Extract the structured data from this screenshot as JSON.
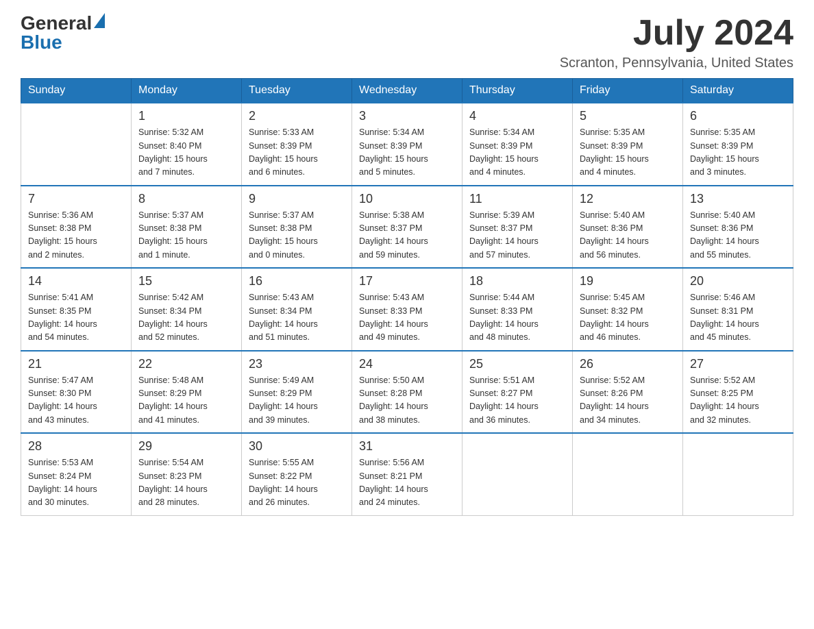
{
  "header": {
    "logo_general": "General",
    "logo_blue": "Blue",
    "month_year": "July 2024",
    "location": "Scranton, Pennsylvania, United States"
  },
  "days_of_week": [
    "Sunday",
    "Monday",
    "Tuesday",
    "Wednesday",
    "Thursday",
    "Friday",
    "Saturday"
  ],
  "weeks": [
    [
      {
        "day": "",
        "info": ""
      },
      {
        "day": "1",
        "info": "Sunrise: 5:32 AM\nSunset: 8:40 PM\nDaylight: 15 hours\nand 7 minutes."
      },
      {
        "day": "2",
        "info": "Sunrise: 5:33 AM\nSunset: 8:39 PM\nDaylight: 15 hours\nand 6 minutes."
      },
      {
        "day": "3",
        "info": "Sunrise: 5:34 AM\nSunset: 8:39 PM\nDaylight: 15 hours\nand 5 minutes."
      },
      {
        "day": "4",
        "info": "Sunrise: 5:34 AM\nSunset: 8:39 PM\nDaylight: 15 hours\nand 4 minutes."
      },
      {
        "day": "5",
        "info": "Sunrise: 5:35 AM\nSunset: 8:39 PM\nDaylight: 15 hours\nand 4 minutes."
      },
      {
        "day": "6",
        "info": "Sunrise: 5:35 AM\nSunset: 8:39 PM\nDaylight: 15 hours\nand 3 minutes."
      }
    ],
    [
      {
        "day": "7",
        "info": "Sunrise: 5:36 AM\nSunset: 8:38 PM\nDaylight: 15 hours\nand 2 minutes."
      },
      {
        "day": "8",
        "info": "Sunrise: 5:37 AM\nSunset: 8:38 PM\nDaylight: 15 hours\nand 1 minute."
      },
      {
        "day": "9",
        "info": "Sunrise: 5:37 AM\nSunset: 8:38 PM\nDaylight: 15 hours\nand 0 minutes."
      },
      {
        "day": "10",
        "info": "Sunrise: 5:38 AM\nSunset: 8:37 PM\nDaylight: 14 hours\nand 59 minutes."
      },
      {
        "day": "11",
        "info": "Sunrise: 5:39 AM\nSunset: 8:37 PM\nDaylight: 14 hours\nand 57 minutes."
      },
      {
        "day": "12",
        "info": "Sunrise: 5:40 AM\nSunset: 8:36 PM\nDaylight: 14 hours\nand 56 minutes."
      },
      {
        "day": "13",
        "info": "Sunrise: 5:40 AM\nSunset: 8:36 PM\nDaylight: 14 hours\nand 55 minutes."
      }
    ],
    [
      {
        "day": "14",
        "info": "Sunrise: 5:41 AM\nSunset: 8:35 PM\nDaylight: 14 hours\nand 54 minutes."
      },
      {
        "day": "15",
        "info": "Sunrise: 5:42 AM\nSunset: 8:34 PM\nDaylight: 14 hours\nand 52 minutes."
      },
      {
        "day": "16",
        "info": "Sunrise: 5:43 AM\nSunset: 8:34 PM\nDaylight: 14 hours\nand 51 minutes."
      },
      {
        "day": "17",
        "info": "Sunrise: 5:43 AM\nSunset: 8:33 PM\nDaylight: 14 hours\nand 49 minutes."
      },
      {
        "day": "18",
        "info": "Sunrise: 5:44 AM\nSunset: 8:33 PM\nDaylight: 14 hours\nand 48 minutes."
      },
      {
        "day": "19",
        "info": "Sunrise: 5:45 AM\nSunset: 8:32 PM\nDaylight: 14 hours\nand 46 minutes."
      },
      {
        "day": "20",
        "info": "Sunrise: 5:46 AM\nSunset: 8:31 PM\nDaylight: 14 hours\nand 45 minutes."
      }
    ],
    [
      {
        "day": "21",
        "info": "Sunrise: 5:47 AM\nSunset: 8:30 PM\nDaylight: 14 hours\nand 43 minutes."
      },
      {
        "day": "22",
        "info": "Sunrise: 5:48 AM\nSunset: 8:29 PM\nDaylight: 14 hours\nand 41 minutes."
      },
      {
        "day": "23",
        "info": "Sunrise: 5:49 AM\nSunset: 8:29 PM\nDaylight: 14 hours\nand 39 minutes."
      },
      {
        "day": "24",
        "info": "Sunrise: 5:50 AM\nSunset: 8:28 PM\nDaylight: 14 hours\nand 38 minutes."
      },
      {
        "day": "25",
        "info": "Sunrise: 5:51 AM\nSunset: 8:27 PM\nDaylight: 14 hours\nand 36 minutes."
      },
      {
        "day": "26",
        "info": "Sunrise: 5:52 AM\nSunset: 8:26 PM\nDaylight: 14 hours\nand 34 minutes."
      },
      {
        "day": "27",
        "info": "Sunrise: 5:52 AM\nSunset: 8:25 PM\nDaylight: 14 hours\nand 32 minutes."
      }
    ],
    [
      {
        "day": "28",
        "info": "Sunrise: 5:53 AM\nSunset: 8:24 PM\nDaylight: 14 hours\nand 30 minutes."
      },
      {
        "day": "29",
        "info": "Sunrise: 5:54 AM\nSunset: 8:23 PM\nDaylight: 14 hours\nand 28 minutes."
      },
      {
        "day": "30",
        "info": "Sunrise: 5:55 AM\nSunset: 8:22 PM\nDaylight: 14 hours\nand 26 minutes."
      },
      {
        "day": "31",
        "info": "Sunrise: 5:56 AM\nSunset: 8:21 PM\nDaylight: 14 hours\nand 24 minutes."
      },
      {
        "day": "",
        "info": ""
      },
      {
        "day": "",
        "info": ""
      },
      {
        "day": "",
        "info": ""
      }
    ]
  ]
}
